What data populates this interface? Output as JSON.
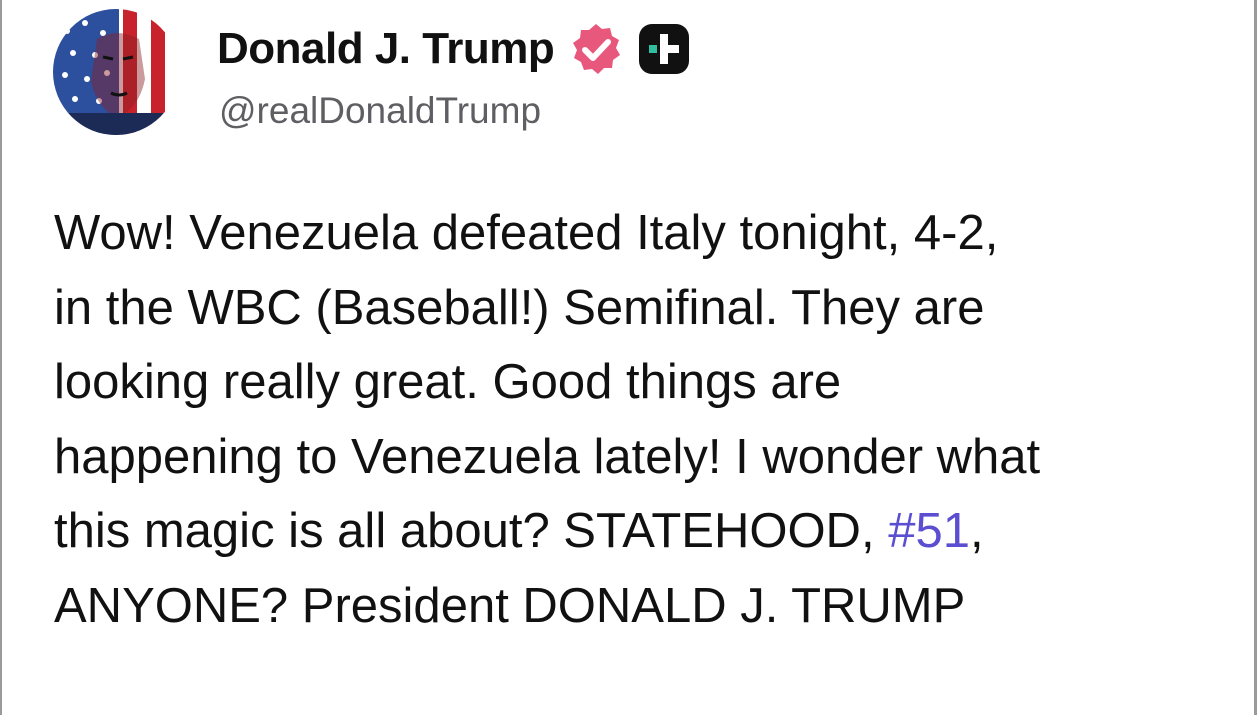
{
  "author": {
    "display_name": "Donald J. Trump",
    "handle": "@realDonaldTrump",
    "verified_badge_color": "#e8587d",
    "plus_badge_color": "#111111"
  },
  "post": {
    "lines": [
      "Wow! Venezuela defeated Italy tonight, 4-2,",
      "in the WBC (Baseball!) Semifinal. They are",
      "looking really great. Good things are",
      "happening to Venezuela lately! I wonder what"
    ],
    "line5_before": "this magic is all about? STATEHOOD, ",
    "hashtag": "#51",
    "line5_after": ",",
    "line6": "ANYONE? President DONALD J. TRUMP",
    "hashtag_color": "#5b4ed1"
  }
}
